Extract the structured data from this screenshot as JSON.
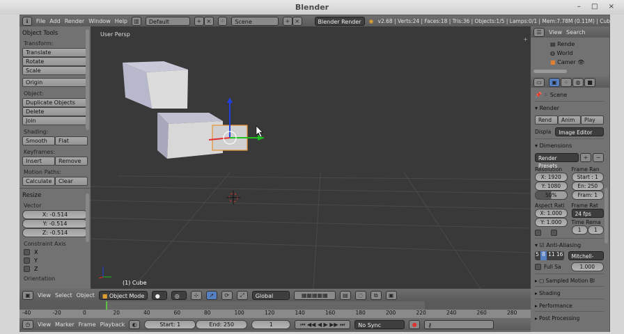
{
  "window": {
    "title": "Blender",
    "controls": "– □ ×"
  },
  "info_header": {
    "menus": [
      "File",
      "Add",
      "Render",
      "Window",
      "Help"
    ],
    "layout": "Default",
    "scene": "Scene",
    "engine": "Blender Render",
    "stats": "v2.68 | Verts:24 | Faces:18 | Tris:36 | Objects:1/5 | Lamps:0/1 | Mem:7.78M (0.11M) | Cub"
  },
  "tools": {
    "title": "Object Tools",
    "transform_label": "Transform:",
    "translate": "Translate",
    "rotate": "Rotate",
    "scale": "Scale",
    "origin": "Origin",
    "object_label": "Object:",
    "duplicate": "Duplicate Objects",
    "delete": "Delete",
    "join": "Join",
    "shading_label": "Shading:",
    "smooth": "Smooth",
    "flat": "Flat",
    "keyframes_label": "Keyframes:",
    "insert": "Insert",
    "remove": "Remove",
    "motion_label": "Motion Paths:",
    "calculate": "Calculate",
    "clear": "Clear"
  },
  "operator": {
    "title": "Resize",
    "vector_label": "Vector",
    "x": "X: -0.514",
    "y": "Y: -0.514",
    "z": "Z: -0.514",
    "constraint_label": "Constraint Axis",
    "axes": [
      "X",
      "Y",
      "Z"
    ],
    "orientation_label": "Orientation"
  },
  "viewport": {
    "label": "User Persp",
    "object": "(1) Cube"
  },
  "view_header": {
    "menus": [
      "View",
      "Select",
      "Object"
    ],
    "mode": "Object Mode",
    "orientation": "Global"
  },
  "timeline": {
    "ticks": [
      "-40",
      "-20",
      "0",
      "20",
      "40",
      "60",
      "80",
      "100",
      "120",
      "140",
      "160",
      "180",
      "200",
      "220",
      "240",
      "260",
      "280"
    ],
    "current_frame": 1
  },
  "timeline_header": {
    "menus": [
      "View",
      "Marker",
      "Frame",
      "Playback"
    ],
    "start": "Start: 1",
    "end": "End: 250",
    "frame": "1",
    "sync": "No Sync"
  },
  "outliner": {
    "menus": [
      "View",
      "Search"
    ],
    "items": [
      "Rende",
      "World",
      "Camer"
    ]
  },
  "properties": {
    "context": "Scene",
    "render": {
      "title": "Render",
      "render_btn": "Rend",
      "anim_btn": "Anim",
      "play_btn": "Play",
      "display_label": "Displa",
      "display": "Image Editor"
    },
    "dimensions": {
      "title": "Dimensions",
      "presets": "Render Presets",
      "resolution_label": "Resolution",
      "res_x": "X: 1920",
      "res_y": "Y: 1080",
      "res_pct": "50%",
      "frame_range_label": "Frame Ran",
      "start": "Start : 1",
      "end": "En: 250",
      "step": "Fram: 1",
      "aspect_label": "Aspect Rati",
      "aspect_x": "X: 1.000",
      "aspect_y": "Y: 1.000",
      "frame_rate_label": "Frame Rat",
      "fps": "24 fps",
      "time_remap_label": "Time Rema",
      "remap_old": "1",
      "remap_new": "1"
    },
    "aa": {
      "title": "Anti-Aliasing",
      "samples": [
        "5",
        "8",
        "11",
        "16"
      ],
      "filter": "Mitchell-",
      "full_sample": "Full Sa",
      "size": "1.000"
    },
    "collapsed": [
      "Sampled Motion Bl",
      "Shading",
      "Performance",
      "Post Processing"
    ]
  }
}
